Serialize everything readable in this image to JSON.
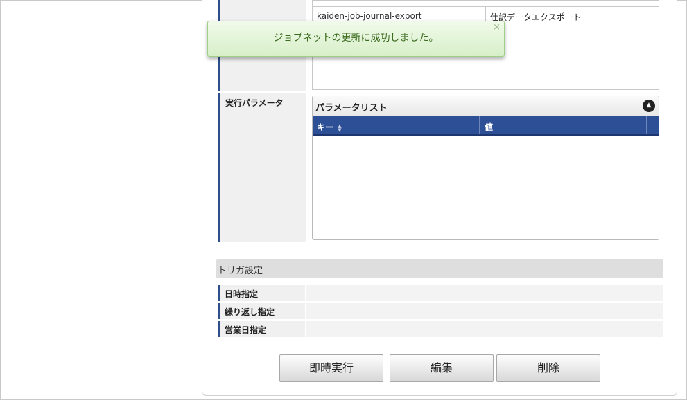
{
  "job_table": {
    "row": {
      "job_id": "kaiden-job-journal-export",
      "job_name": "仕訳データエクスポート"
    }
  },
  "params": {
    "label": "実行パラメータ",
    "panel_title": "パラメータリスト",
    "col_key": "キー",
    "col_value": "値",
    "sort_icon": "sort-arrows-icon",
    "collapse_icon": "collapse-up-icon"
  },
  "trigger": {
    "section_title": "トリガ設定",
    "datetime_label": "日時指定",
    "repeat_label": "繰り返し指定",
    "business_day_label": "営業日指定"
  },
  "buttons": {
    "run": "即時実行",
    "edit": "編集",
    "delete": "削除"
  },
  "toast": {
    "message": "ジョブネットの更新に成功しました。",
    "close_symbol": "×"
  },
  "colors": {
    "accent_blue": "#2d4f95",
    "toast_green": "#3b6a1e"
  }
}
